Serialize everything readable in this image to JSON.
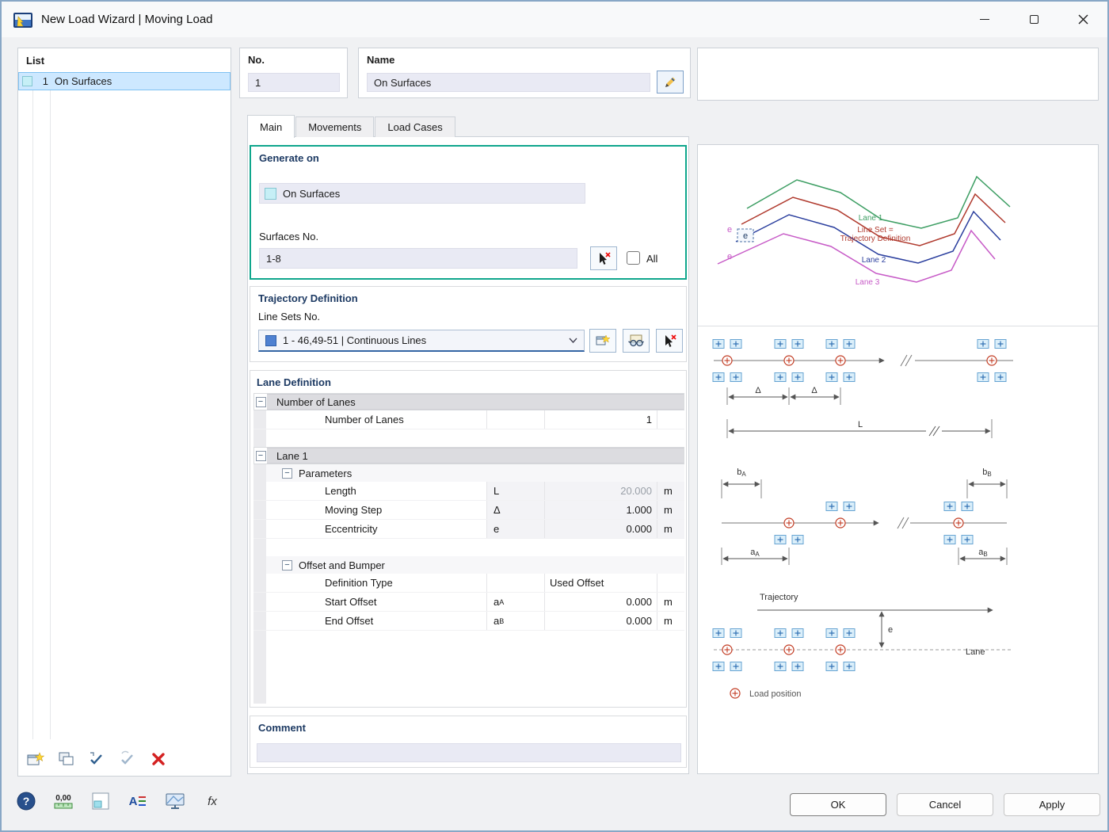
{
  "window": {
    "title": "New Load Wizard | Moving Load"
  },
  "list_panel": {
    "header": "List",
    "items": [
      {
        "number": "1",
        "label": "On Surfaces",
        "selected": true
      }
    ]
  },
  "no_field": {
    "label": "No.",
    "value": "1"
  },
  "name_field": {
    "label": "Name",
    "value": "On Surfaces"
  },
  "tabs": [
    {
      "label": "Main",
      "active": true
    },
    {
      "label": "Movements",
      "active": false
    },
    {
      "label": "Load Cases",
      "active": false
    }
  ],
  "generate_on": {
    "header": "Generate on",
    "type_value": "On Surfaces",
    "surfaces_label": "Surfaces No.",
    "surfaces_value": "1-8",
    "all_checkbox_label": "All",
    "highlight_color": "#0fa68c"
  },
  "trajectory": {
    "header": "Trajectory Definition",
    "line_sets_label": "Line Sets No.",
    "line_sets_value": "1 - 46,49-51 | Continuous Lines"
  },
  "lane_definition": {
    "header": "Lane Definition",
    "collapse_glyph": "−",
    "rows": [
      {
        "type": "group",
        "label": "Number of Lanes"
      },
      {
        "type": "data",
        "label": "Number of Lanes",
        "symbol": "",
        "value": "1",
        "unit": "",
        "align": "right"
      },
      {
        "type": "spacer"
      },
      {
        "type": "group",
        "label": "Lane 1"
      },
      {
        "type": "subgroup",
        "label": "Parameters"
      },
      {
        "type": "data",
        "label": "Length",
        "symbol": "L",
        "value": "20.000",
        "unit": "m",
        "align": "right",
        "disabled": true,
        "shaded": true
      },
      {
        "type": "data",
        "label": "Moving Step",
        "symbol": "Δ",
        "value": "1.000",
        "unit": "m",
        "align": "right",
        "shaded": true
      },
      {
        "type": "data",
        "label": "Eccentricity",
        "symbol": "e",
        "value": "0.000",
        "unit": "m",
        "align": "right",
        "shaded": true
      },
      {
        "type": "spacer"
      },
      {
        "type": "subgroup",
        "label": "Offset and Bumper"
      },
      {
        "type": "data",
        "label": "Definition Type",
        "symbol": "",
        "value": "Used Offset",
        "unit": "",
        "align": "left"
      },
      {
        "type": "data",
        "label": "Start Offset",
        "symbol": "a",
        "symbol_sub": "A",
        "value": "0.000",
        "unit": "m",
        "align": "right"
      },
      {
        "type": "data",
        "label": "End Offset",
        "symbol": "a",
        "symbol_sub": "B",
        "value": "0.000",
        "unit": "m",
        "align": "right"
      }
    ]
  },
  "comment": {
    "header": "Comment",
    "value": ""
  },
  "diagram": {
    "lanes": {
      "lane1": "Lane 1",
      "lineset_line1": "Line Set =",
      "lineset_line2": "Trajectory Definition",
      "lane2": "Lane 2",
      "lane3": "Lane 3",
      "ecc": "e",
      "colors": {
        "lane1": "#3d9e63",
        "lineset": "#b03a2e",
        "lane2": "#2b3f9e",
        "lane3": "#c75bc7"
      }
    },
    "scheme": {
      "delta": "Δ",
      "length": "L",
      "b_start": {
        "base": "b",
        "sub": "A"
      },
      "b_end": {
        "base": "b",
        "sub": "B"
      },
      "a_start": {
        "base": "a",
        "sub": "A"
      },
      "a_end": {
        "base": "a",
        "sub": "B"
      },
      "trajectory": "Trajectory",
      "lane": "Lane",
      "ecc": "e",
      "legend_load_position": "Load position"
    }
  },
  "footer": {
    "ok": "OK",
    "cancel": "Cancel",
    "apply": "Apply",
    "icons": {
      "help_text": "?",
      "units_text": "0,00",
      "annotation_text": "A",
      "formula_text": "fx"
    }
  }
}
